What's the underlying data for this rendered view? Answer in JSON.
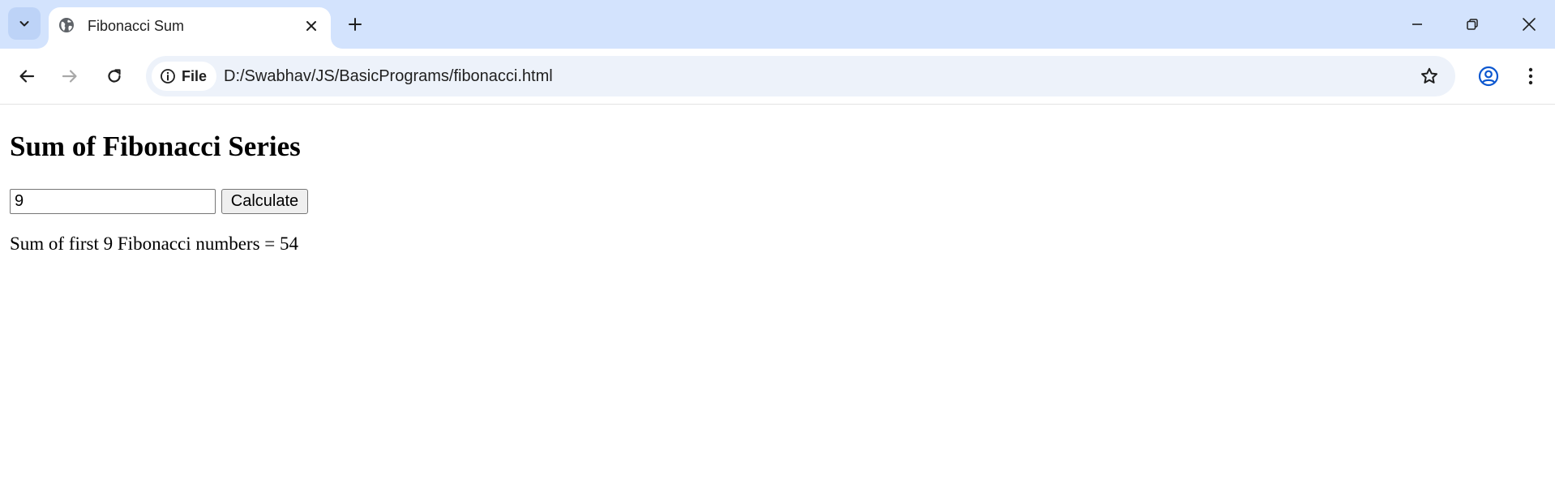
{
  "browser": {
    "tab": {
      "title": "Fibonacci Sum"
    },
    "omnibox": {
      "site_chip_label": "File",
      "url": "D:/Swabhav/JS/BasicPrograms/fibonacci.html"
    },
    "icons": {
      "tab_search": "chevron-down-icon",
      "favicon": "globe-icon",
      "tab_close": "close-icon",
      "new_tab": "plus-icon",
      "minimize": "minimize-icon",
      "restore": "restore-icon",
      "close_window": "close-icon",
      "back": "arrow-left-icon",
      "forward": "arrow-right-icon",
      "reload": "reload-icon",
      "site_info": "info-icon",
      "bookmark": "star-icon",
      "profile": "profile-icon",
      "menu": "more-vertical-icon"
    },
    "colors": {
      "tabstrip_bg": "#d3e3fd",
      "omnibox_bg": "#edf2fa",
      "profile_accent": "#0b57d0"
    }
  },
  "page": {
    "title": "Sum of Fibonacci Series",
    "input": {
      "value": "9"
    },
    "calculate_button_label": "Calculate",
    "result_text": "Sum of first 9 Fibonacci numbers = 54"
  }
}
